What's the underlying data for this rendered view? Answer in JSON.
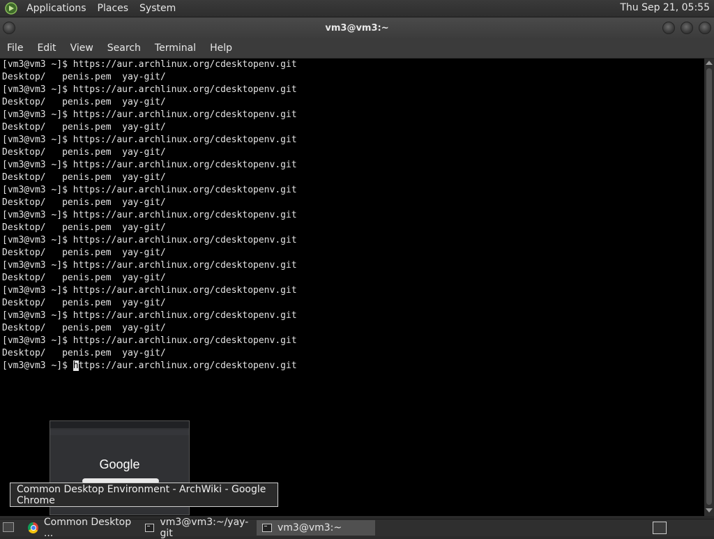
{
  "top_panel": {
    "menus": [
      "Applications",
      "Places",
      "System"
    ],
    "clock": "Thu Sep 21, 05:55"
  },
  "window": {
    "title": "vm3@vm3:~",
    "menu": [
      "File",
      "Edit",
      "View",
      "Search",
      "Terminal",
      "Help"
    ]
  },
  "terminal": {
    "lines": [
      "[vm3@vm3 ~]$ https://aur.archlinux.org/cdesktopenv.git",
      "Desktop/   penis.pem  yay-git/",
      "[vm3@vm3 ~]$ https://aur.archlinux.org/cdesktopenv.git",
      "Desktop/   penis.pem  yay-git/",
      "[vm3@vm3 ~]$ https://aur.archlinux.org/cdesktopenv.git",
      "Desktop/   penis.pem  yay-git/",
      "[vm3@vm3 ~]$ https://aur.archlinux.org/cdesktopenv.git",
      "Desktop/   penis.pem  yay-git/",
      "[vm3@vm3 ~]$ https://aur.archlinux.org/cdesktopenv.git",
      "Desktop/   penis.pem  yay-git/",
      "[vm3@vm3 ~]$ https://aur.archlinux.org/cdesktopenv.git",
      "Desktop/   penis.pem  yay-git/",
      "[vm3@vm3 ~]$ https://aur.archlinux.org/cdesktopenv.git",
      "Desktop/   penis.pem  yay-git/",
      "[vm3@vm3 ~]$ https://aur.archlinux.org/cdesktopenv.git",
      "Desktop/   penis.pem  yay-git/",
      "[vm3@vm3 ~]$ https://aur.archlinux.org/cdesktopenv.git",
      "Desktop/   penis.pem  yay-git/",
      "[vm3@vm3 ~]$ https://aur.archlinux.org/cdesktopenv.git",
      "Desktop/   penis.pem  yay-git/",
      "[vm3@vm3 ~]$ https://aur.archlinux.org/cdesktopenv.git",
      "Desktop/   penis.pem  yay-git/",
      "[vm3@vm3 ~]$ https://aur.archlinux.org/cdesktopenv.git",
      "Desktop/   penis.pem  yay-git/"
    ],
    "prompt": "[vm3@vm3 ~]$ ",
    "cursor_char": "h",
    "input_rest": "ttps://aur.archlinux.org/cdesktopenv.git"
  },
  "thumbnail": {
    "logo_text": "Google"
  },
  "tooltip": "Common Desktop Environment - ArchWiki - Google Chrome",
  "taskbar": {
    "tasks": [
      {
        "label": "Common Desktop ...",
        "icon": "chrome-icon"
      },
      {
        "label": "vm3@vm3:~/yay-git",
        "icon": "terminal-icon"
      },
      {
        "label": "vm3@vm3:~",
        "icon": "terminal-icon"
      }
    ]
  },
  "colors": {
    "terminal_bg": "#000000",
    "terminal_fg": "#e4e4e4",
    "panel_bg": "#2f2f2f"
  }
}
